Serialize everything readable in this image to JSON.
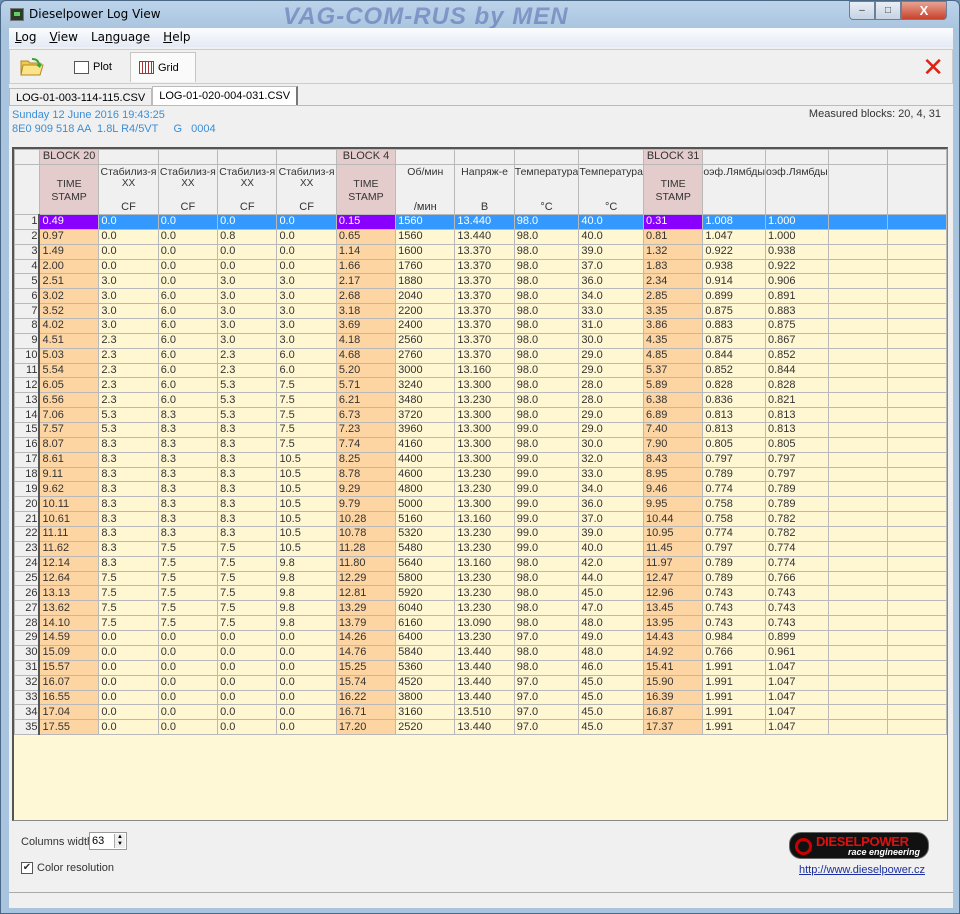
{
  "window": {
    "title": "Dieselpower Log View",
    "watermark": "VAG-COM-RUS by MEN",
    "min": "–",
    "max": "□",
    "close": "X"
  },
  "menu": [
    {
      "pre": "",
      "u": "L",
      "post": "og"
    },
    {
      "pre": "",
      "u": "V",
      "post": "iew"
    },
    {
      "pre": "La",
      "u": "n",
      "post": "guage"
    },
    {
      "pre": "",
      "u": "H",
      "post": "elp"
    }
  ],
  "toolbar": {
    "open_icon": "folder-open-icon",
    "plot_label": "Plot",
    "grid_label": "Grid",
    "close_icon": "✕"
  },
  "tabs": [
    {
      "label": "LOG-01-003-114-115.CSV",
      "active": false
    },
    {
      "label": "LOG-01-020-004-031.CSV",
      "active": true
    }
  ],
  "info": {
    "date": "Sunday 12 June 2016 19:43:25",
    "ecu": "8E0 909 518 AA  1.8L R4/5VT     G   0004",
    "measured": "Measured blocks: 20, 4, 31"
  },
  "colors": {
    "timestamp": "#fdd5a3",
    "cell": "#fff6d2",
    "selected_row": "#3399ff",
    "selected_timestamp": "#8a00ff",
    "info_text": "#3c8ed6"
  },
  "columns": [
    {
      "group": "BLOCK 20",
      "name": "TIME",
      "sub": "STAMP",
      "unit": "",
      "ts": true
    },
    {
      "group": "",
      "name": "Стабилиз-я",
      "sub": "XX",
      "unit": "CF",
      "ts": false
    },
    {
      "group": "",
      "name": "Стабилиз-я",
      "sub": "XX",
      "unit": "CF",
      "ts": false
    },
    {
      "group": "",
      "name": "Стабилиз-я",
      "sub": "XX",
      "unit": "CF",
      "ts": false
    },
    {
      "group": "",
      "name": "Стабилиз-я",
      "sub": "XX",
      "unit": "CF",
      "ts": false
    },
    {
      "group": "BLOCK 4",
      "name": "TIME",
      "sub": "STAMP",
      "unit": "",
      "ts": true
    },
    {
      "group": "",
      "name": "Об/мин",
      "sub": "",
      "unit": "/мин",
      "ts": false
    },
    {
      "group": "",
      "name": "Напряж-е",
      "sub": "",
      "unit": "В",
      "ts": false
    },
    {
      "group": "",
      "name": "Температура",
      "sub": "",
      "unit": "°C",
      "ts": false
    },
    {
      "group": "",
      "name": "Температура",
      "sub": "",
      "unit": "°C",
      "ts": false
    },
    {
      "group": "BLOCK 31",
      "name": "TIME",
      "sub": "STAMP",
      "unit": "",
      "ts": true
    },
    {
      "group": "",
      "name": "оэф.Лямбды",
      "sub": "",
      "unit": "",
      "ts": false
    },
    {
      "group": "",
      "name": "оэф.Лямбды",
      "sub": "",
      "unit": "",
      "ts": false
    },
    {
      "group": "",
      "name": "",
      "sub": "",
      "unit": "",
      "ts": false
    },
    {
      "group": "",
      "name": "",
      "sub": "",
      "unit": "",
      "ts": false
    }
  ],
  "selected_row": 1,
  "rows": [
    [
      "0.49",
      "0.0",
      "0.0",
      "0.0",
      "0.0",
      "0.15",
      "1560",
      "13.440",
      "98.0",
      "40.0",
      "0.31",
      "1.008",
      "1.000"
    ],
    [
      "0.97",
      "0.0",
      "0.0",
      "0.8",
      "0.0",
      "0.65",
      "1560",
      "13.440",
      "98.0",
      "40.0",
      "0.81",
      "1.047",
      "1.000"
    ],
    [
      "1.49",
      "0.0",
      "0.0",
      "0.0",
      "0.0",
      "1.14",
      "1600",
      "13.370",
      "98.0",
      "39.0",
      "1.32",
      "0.922",
      "0.938"
    ],
    [
      "2.00",
      "0.0",
      "0.0",
      "0.0",
      "0.0",
      "1.66",
      "1760",
      "13.370",
      "98.0",
      "37.0",
      "1.83",
      "0.938",
      "0.922"
    ],
    [
      "2.51",
      "3.0",
      "0.0",
      "3.0",
      "3.0",
      "2.17",
      "1880",
      "13.370",
      "98.0",
      "36.0",
      "2.34",
      "0.914",
      "0.906"
    ],
    [
      "3.02",
      "3.0",
      "6.0",
      "3.0",
      "3.0",
      "2.68",
      "2040",
      "13.370",
      "98.0",
      "34.0",
      "2.85",
      "0.899",
      "0.891"
    ],
    [
      "3.52",
      "3.0",
      "6.0",
      "3.0",
      "3.0",
      "3.18",
      "2200",
      "13.370",
      "98.0",
      "33.0",
      "3.35",
      "0.875",
      "0.883"
    ],
    [
      "4.02",
      "3.0",
      "6.0",
      "3.0",
      "3.0",
      "3.69",
      "2400",
      "13.370",
      "98.0",
      "31.0",
      "3.86",
      "0.883",
      "0.875"
    ],
    [
      "4.51",
      "2.3",
      "6.0",
      "3.0",
      "3.0",
      "4.18",
      "2560",
      "13.370",
      "98.0",
      "30.0",
      "4.35",
      "0.875",
      "0.867"
    ],
    [
      "5.03",
      "2.3",
      "6.0",
      "2.3",
      "6.0",
      "4.68",
      "2760",
      "13.370",
      "98.0",
      "29.0",
      "4.85",
      "0.844",
      "0.852"
    ],
    [
      "5.54",
      "2.3",
      "6.0",
      "2.3",
      "6.0",
      "5.20",
      "3000",
      "13.160",
      "98.0",
      "29.0",
      "5.37",
      "0.852",
      "0.844"
    ],
    [
      "6.05",
      "2.3",
      "6.0",
      "5.3",
      "7.5",
      "5.71",
      "3240",
      "13.300",
      "98.0",
      "28.0",
      "5.89",
      "0.828",
      "0.828"
    ],
    [
      "6.56",
      "2.3",
      "6.0",
      "5.3",
      "7.5",
      "6.21",
      "3480",
      "13.230",
      "98.0",
      "28.0",
      "6.38",
      "0.836",
      "0.821"
    ],
    [
      "7.06",
      "5.3",
      "8.3",
      "5.3",
      "7.5",
      "6.73",
      "3720",
      "13.300",
      "98.0",
      "29.0",
      "6.89",
      "0.813",
      "0.813"
    ],
    [
      "7.57",
      "5.3",
      "8.3",
      "8.3",
      "7.5",
      "7.23",
      "3960",
      "13.300",
      "99.0",
      "29.0",
      "7.40",
      "0.813",
      "0.813"
    ],
    [
      "8.07",
      "8.3",
      "8.3",
      "8.3",
      "7.5",
      "7.74",
      "4160",
      "13.300",
      "98.0",
      "30.0",
      "7.90",
      "0.805",
      "0.805"
    ],
    [
      "8.61",
      "8.3",
      "8.3",
      "8.3",
      "10.5",
      "8.25",
      "4400",
      "13.300",
      "99.0",
      "32.0",
      "8.43",
      "0.797",
      "0.797"
    ],
    [
      "9.11",
      "8.3",
      "8.3",
      "8.3",
      "10.5",
      "8.78",
      "4600",
      "13.230",
      "99.0",
      "33.0",
      "8.95",
      "0.789",
      "0.797"
    ],
    [
      "9.62",
      "8.3",
      "8.3",
      "8.3",
      "10.5",
      "9.29",
      "4800",
      "13.230",
      "99.0",
      "34.0",
      "9.46",
      "0.774",
      "0.789"
    ],
    [
      "10.11",
      "8.3",
      "8.3",
      "8.3",
      "10.5",
      "9.79",
      "5000",
      "13.300",
      "99.0",
      "36.0",
      "9.95",
      "0.758",
      "0.789"
    ],
    [
      "10.61",
      "8.3",
      "8.3",
      "8.3",
      "10.5",
      "10.28",
      "5160",
      "13.160",
      "99.0",
      "37.0",
      "10.44",
      "0.758",
      "0.782"
    ],
    [
      "11.11",
      "8.3",
      "8.3",
      "8.3",
      "10.5",
      "10.78",
      "5320",
      "13.230",
      "99.0",
      "39.0",
      "10.95",
      "0.774",
      "0.782"
    ],
    [
      "11.62",
      "8.3",
      "7.5",
      "7.5",
      "10.5",
      "11.28",
      "5480",
      "13.230",
      "99.0",
      "40.0",
      "11.45",
      "0.797",
      "0.774"
    ],
    [
      "12.14",
      "8.3",
      "7.5",
      "7.5",
      "9.8",
      "11.80",
      "5640",
      "13.160",
      "98.0",
      "42.0",
      "11.97",
      "0.789",
      "0.774"
    ],
    [
      "12.64",
      "7.5",
      "7.5",
      "7.5",
      "9.8",
      "12.29",
      "5800",
      "13.230",
      "98.0",
      "44.0",
      "12.47",
      "0.789",
      "0.766"
    ],
    [
      "13.13",
      "7.5",
      "7.5",
      "7.5",
      "9.8",
      "12.81",
      "5920",
      "13.230",
      "98.0",
      "45.0",
      "12.96",
      "0.743",
      "0.743"
    ],
    [
      "13.62",
      "7.5",
      "7.5",
      "7.5",
      "9.8",
      "13.29",
      "6040",
      "13.230",
      "98.0",
      "47.0",
      "13.45",
      "0.743",
      "0.743"
    ],
    [
      "14.10",
      "7.5",
      "7.5",
      "7.5",
      "9.8",
      "13.79",
      "6160",
      "13.090",
      "98.0",
      "48.0",
      "13.95",
      "0.743",
      "0.743"
    ],
    [
      "14.59",
      "0.0",
      "0.0",
      "0.0",
      "0.0",
      "14.26",
      "6400",
      "13.230",
      "97.0",
      "49.0",
      "14.43",
      "0.984",
      "0.899"
    ],
    [
      "15.09",
      "0.0",
      "0.0",
      "0.0",
      "0.0",
      "14.76",
      "5840",
      "13.440",
      "98.0",
      "48.0",
      "14.92",
      "0.766",
      "0.961"
    ],
    [
      "15.57",
      "0.0",
      "0.0",
      "0.0",
      "0.0",
      "15.25",
      "5360",
      "13.440",
      "98.0",
      "46.0",
      "15.41",
      "1.991",
      "1.047"
    ],
    [
      "16.07",
      "0.0",
      "0.0",
      "0.0",
      "0.0",
      "15.74",
      "4520",
      "13.440",
      "97.0",
      "45.0",
      "15.90",
      "1.991",
      "1.047"
    ],
    [
      "16.55",
      "0.0",
      "0.0",
      "0.0",
      "0.0",
      "16.22",
      "3800",
      "13.440",
      "97.0",
      "45.0",
      "16.39",
      "1.991",
      "1.047"
    ],
    [
      "17.04",
      "0.0",
      "0.0",
      "0.0",
      "0.0",
      "16.71",
      "3160",
      "13.510",
      "97.0",
      "45.0",
      "16.87",
      "1.991",
      "1.047"
    ],
    [
      "17.55",
      "0.0",
      "0.0",
      "0.0",
      "0.0",
      "17.20",
      "2520",
      "13.440",
      "97.0",
      "45.0",
      "17.37",
      "1.991",
      "1.047"
    ]
  ],
  "bottom": {
    "columns_width_label": "Columns width:",
    "columns_width_value": "63",
    "color_resolution_label": "Color resolution",
    "color_resolution_checked": true,
    "logo_text": "DIESELPOWER",
    "logo_sub": "race engineering",
    "link": "http://www.dieselpower.cz"
  }
}
